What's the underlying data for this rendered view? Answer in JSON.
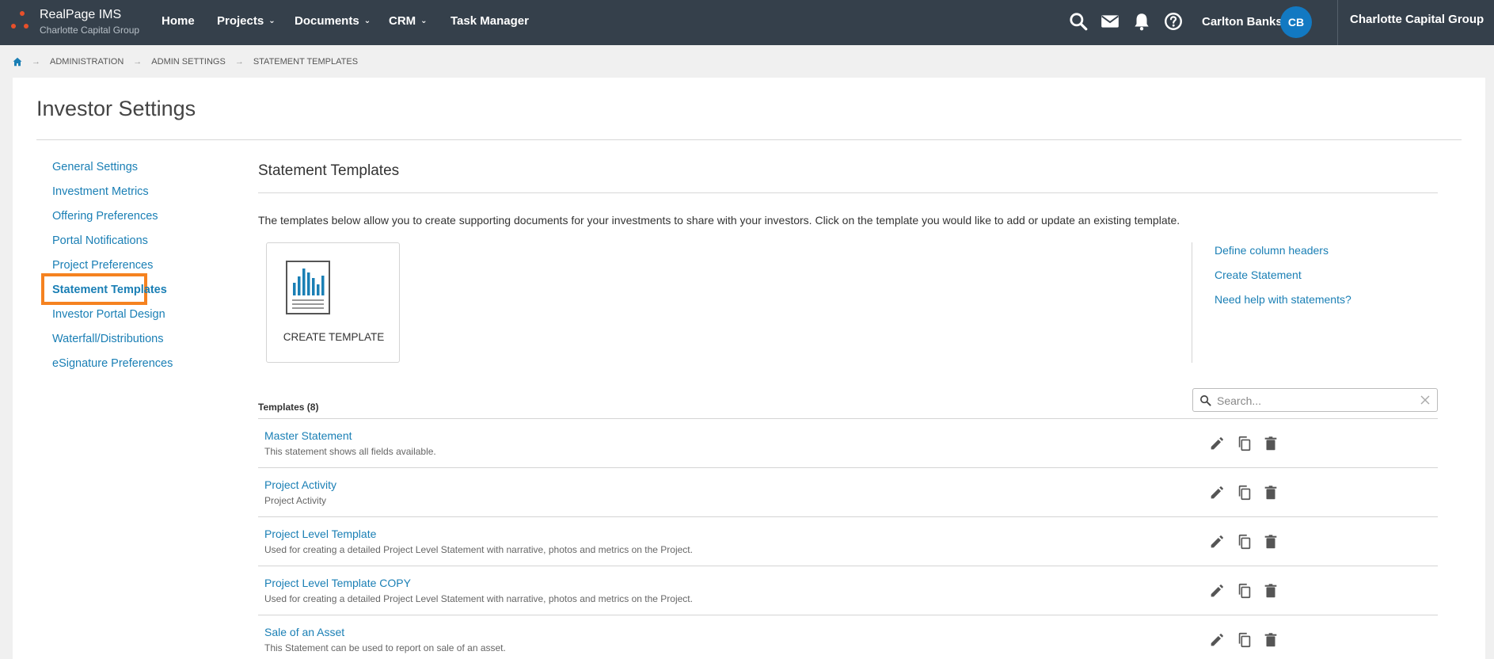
{
  "app": {
    "brand_title": "RealPage IMS",
    "brand_subtitle": "Charlotte Capital Group",
    "accent_color": "#e8502a"
  },
  "nav": {
    "home": "Home",
    "projects": "Projects",
    "documents": "Documents",
    "crm": "CRM",
    "task_manager": "Task Manager",
    "caret": "⌄"
  },
  "user": {
    "name": "Carlton Banks",
    "initials": "CB",
    "org": "Charlotte Capital Group",
    "org_caret": "⌄"
  },
  "icons": [
    "search-icon",
    "mail-icon",
    "bell-icon",
    "help-icon",
    "home-icon",
    "pencil-icon",
    "copy-icon",
    "trash-icon",
    "close-icon",
    "chart-document-icon"
  ],
  "breadcrumb": {
    "items": [
      "ADMINISTRATION",
      "ADMIN SETTINGS",
      "STATEMENT TEMPLATES"
    ],
    "separator": "→"
  },
  "page": {
    "title": "Investor Settings"
  },
  "side_menu": {
    "items": [
      "General Settings",
      "Investment Metrics",
      "Offering Preferences",
      "Portal Notifications",
      "Project Preferences",
      "Statement Templates",
      "Investor Portal Design",
      "Waterfall/Distributions",
      "eSignature Preferences"
    ],
    "active": "Statement Templates"
  },
  "main": {
    "section_title": "Statement Templates",
    "intro": "The templates below allow you to create supporting documents for your investments to share with your investors. Click on the template you would like to add or update an existing template.",
    "create_tile_label": "CREATE TEMPLATE",
    "help_links": [
      "Define column headers",
      "Create Statement",
      "Need help with statements?"
    ],
    "templates_heading": "Templates (8)",
    "search": {
      "placeholder": "Search...",
      "value": ""
    },
    "templates": [
      {
        "title": "Master Statement",
        "description": "This statement shows all fields available."
      },
      {
        "title": "Project Activity",
        "description": "Project Activity"
      },
      {
        "title": "Project Level Template",
        "description": "Used for creating a detailed Project Level Statement with narrative, photos and metrics on the Project."
      },
      {
        "title": "Project Level Template COPY",
        "description": "Used for creating a detailed Project Level Statement with narrative, photos and metrics on the Project."
      },
      {
        "title": "Sale of an Asset",
        "description": "This Statement can be used to report on sale of an asset."
      }
    ]
  },
  "colors": {
    "topbar": "#35404b",
    "link": "#1a7fb5",
    "avatar": "#1279c2",
    "highlight": "#f58220"
  }
}
